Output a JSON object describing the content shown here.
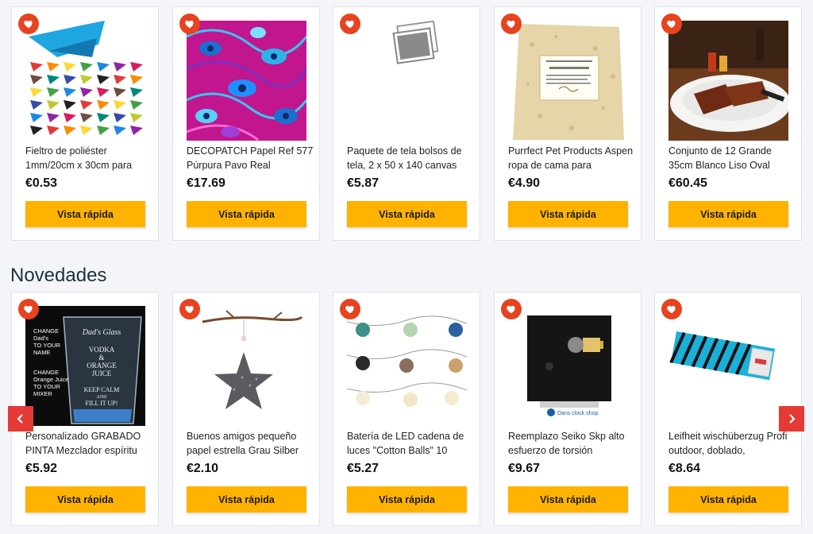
{
  "top_row": [
    {
      "title": "Fieltro de poliéster 1mm/20cm x 30cm para",
      "price": "€0.53",
      "button": "Vista rápida",
      "image": "felt-cones-image"
    },
    {
      "title": "DECOPATCH Papel Ref 577 Púrpura Pavo Real",
      "price": "€17.69",
      "button": "Vista rápida",
      "image": "peacock-paper-image"
    },
    {
      "title": "Paquete de tela bolsos de tela, 2 x 50 x 140 canvas",
      "price": "€5.87",
      "button": "Vista rápida",
      "image": "placeholder-photo-image"
    },
    {
      "title": "Purrfect Pet Products Aspen ropa de cama para",
      "price": "€4.90",
      "button": "Vista rápida",
      "image": "aspen-bedding-image"
    },
    {
      "title": "Conjunto de 12 Grande 35cm Blanco Liso Oval",
      "price": "€60.45",
      "button": "Vista rápida",
      "image": "ribs-platter-image"
    }
  ],
  "section": {
    "title": "Novedades"
  },
  "bottom_row": [
    {
      "title": "Personalizado GRABADO PINTA Mezclador espíritu",
      "price": "€5.92",
      "button": "Vista rápida",
      "image": "engraved-glass-image",
      "glass_text": {
        "left": [
          "CHANGE",
          "Dad's",
          "TO YOUR",
          "NAME",
          "CHANGE",
          "Orange Juice",
          "TO YOUR",
          "MIXER"
        ],
        "glass": [
          "Dad's Glass",
          "VODKA",
          "&",
          "ORANGE",
          "JUICE",
          "KEEP CALM",
          "AND",
          "FILL IT UP!"
        ]
      }
    },
    {
      "title": "Buenos amigos pequeño papel estrella Grau Silber",
      "price": "€2.10",
      "button": "Vista rápida",
      "image": "star-ornament-image"
    },
    {
      "title": "Batería de LED cadena de luces \"Cotton Balls\" 10",
      "price": "€5.27",
      "button": "Vista rápida",
      "image": "cotton-ball-lights-image"
    },
    {
      "title": "Reemplazo Seiko Skp alto esfuerzo de torsión",
      "price": "€9.67",
      "button": "Vista rápida",
      "image": "clock-movement-image",
      "brand_text": "Dans clock shop"
    },
    {
      "title": "Leifheit wischüberzug Profi outdoor, doblado,",
      "price": "€8.64",
      "button": "Vista rápida",
      "image": "mop-cover-image"
    }
  ],
  "colors": {
    "accent": "#e8421f",
    "button": "#ffb300",
    "arrow": "#e53935",
    "heading": "#1d3142"
  },
  "icons": {
    "favorite": "heart-icon",
    "prev": "chevron-left-icon",
    "next": "chevron-right-icon"
  }
}
